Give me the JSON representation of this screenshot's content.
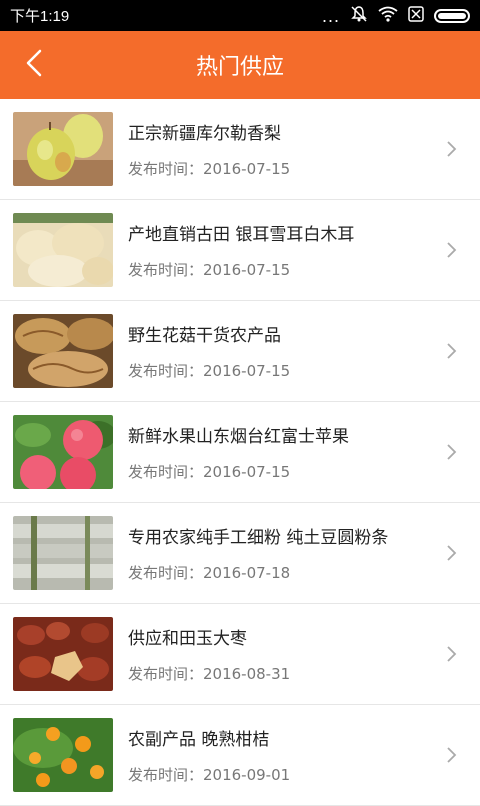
{
  "status": {
    "time": "下午1:19",
    "dots": "...",
    "icons": [
      "mute-icon",
      "wifi-icon",
      "sim-icon",
      "battery-icon"
    ]
  },
  "header": {
    "title": "热门供应",
    "back_icon": "back-chevron-icon"
  },
  "items": [
    {
      "name": "正宗新疆库尔勒香梨",
      "date": "发布时间：2016-07-15",
      "thumb": "pear"
    },
    {
      "name": "产地直销古田 银耳雪耳白木耳",
      "date": "发布时间：2016-07-15",
      "thumb": "fungus"
    },
    {
      "name": "野生花菇干货农产品",
      "date": "发布时间：2016-07-15",
      "thumb": "mushroom"
    },
    {
      "name": "新鲜水果山东烟台红富士苹果",
      "date": "发布时间：2016-07-15",
      "thumb": "apple"
    },
    {
      "name": "专用农家纯手工细粉 纯土豆圆粉条",
      "date": "发布时间：2016-07-18",
      "thumb": "noodles"
    },
    {
      "name": "供应和田玉大枣",
      "date": "发布时间：2016-08-31",
      "thumb": "jujube"
    },
    {
      "name": "农副产品 晚熟柑桔",
      "date": "发布时间：2016-09-01",
      "thumb": "orange"
    }
  ],
  "colors": {
    "accent": "#f46c2b",
    "statusbar": "#000000"
  }
}
